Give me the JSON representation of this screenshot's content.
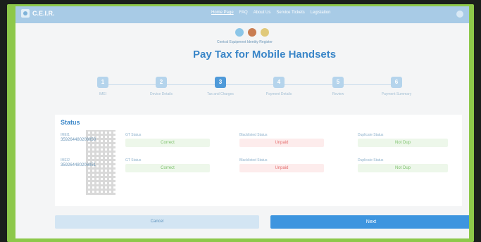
{
  "header": {
    "logo_text": "C.E.I.R.",
    "nav": [
      "Home Page",
      "FAQ",
      "About Us",
      "Service Tickets",
      "Legislation"
    ]
  },
  "department": "Central Equipment Identity Register",
  "page_title": "Pay Tax for Mobile Handsets",
  "steps": [
    {
      "number": "1",
      "label": "IMEI"
    },
    {
      "number": "2",
      "label": "Device Details"
    },
    {
      "number": "3",
      "label": "Tax and Charges"
    },
    {
      "number": "4",
      "label": "Payment Details"
    },
    {
      "number": "5",
      "label": "Review"
    },
    {
      "number": "6",
      "label": "Payment Summary"
    }
  ],
  "status": {
    "heading": "Status",
    "rows": [
      {
        "imei_label": "IMEI1",
        "imei_value": "359264480206050",
        "gt_label": "GT Status",
        "gt_status": "Correct",
        "bl_label": "Blacklisted Status",
        "bl_status": "Unpaid",
        "dup_label": "Duplicate Status",
        "dup_status": "Not Dup"
      },
      {
        "imei_label": "IMEI2",
        "imei_value": "359264480206051",
        "gt_label": "GT Status",
        "gt_status": "Correct",
        "bl_label": "Blacklisted Status",
        "bl_status": "Unpaid",
        "dup_label": "Duplicate Status",
        "dup_status": "Not Dup"
      }
    ]
  },
  "buttons": {
    "cancel": "Cancel",
    "next": "Next"
  }
}
